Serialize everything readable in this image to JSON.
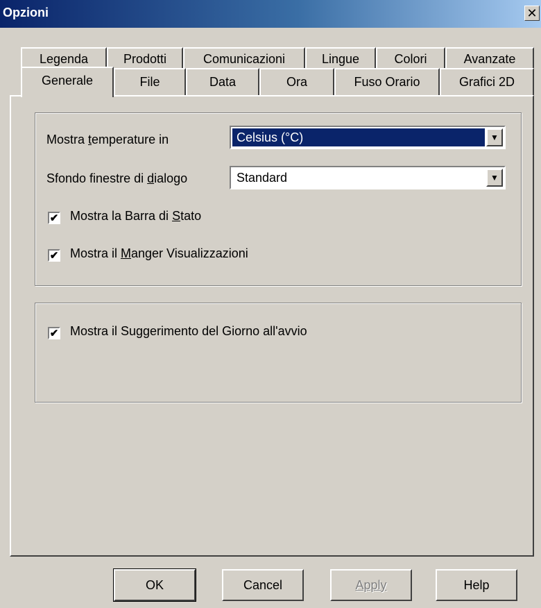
{
  "window": {
    "title": "Opzioni",
    "close_glyph": "✕"
  },
  "tabs": {
    "row1": [
      "Legenda",
      "Prodotti",
      "Comunicazioni",
      "Lingue",
      "Colori",
      "Avanzate"
    ],
    "row2": [
      "Generale",
      "File",
      "Data",
      "Ora",
      "Fuso Orario",
      "Grafici 2D"
    ],
    "active": "Generale"
  },
  "general": {
    "temp_label_pre": "Mostra ",
    "temp_label_key": "t",
    "temp_label_post": "emperature in",
    "temp_value": "Celsius (°C)",
    "bg_label_pre": "Sfondo finestre di ",
    "bg_label_key": "d",
    "bg_label_post": "ialogo",
    "bg_value": "Standard",
    "statusbar_pre": "Mostra la Barra di ",
    "statusbar_key": "S",
    "statusbar_post": "tato",
    "statusbar_checked": true,
    "manager_pre": "Mostra il ",
    "manager_key": "M",
    "manager_post": "anger Visualizzazioni",
    "manager_checked": true
  },
  "tips": {
    "label": "Mostra il Suggerimento del Giorno all'avvio",
    "checked": true
  },
  "buttons": {
    "ok": "OK",
    "cancel": "Cancel",
    "apply": "Apply",
    "help": "Help"
  },
  "icons": {
    "dropdown": "▼",
    "check": "✔"
  }
}
